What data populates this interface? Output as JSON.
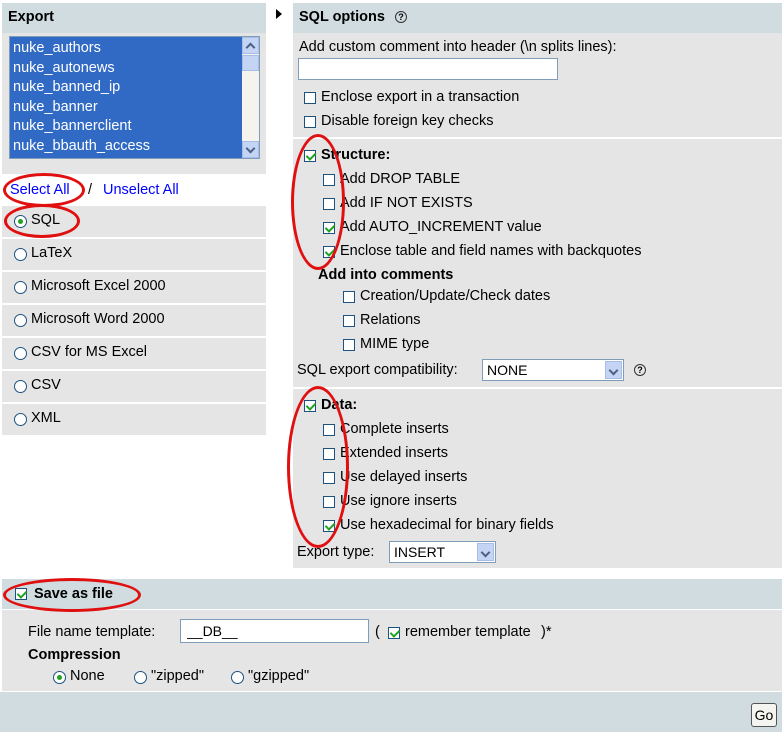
{
  "export": {
    "header": "Export",
    "tables": [
      "nuke_authors",
      "nuke_autonews",
      "nuke_banned_ip",
      "nuke_banner",
      "nuke_bannerclient",
      "nuke_bbauth_access"
    ],
    "select_all": "Select All",
    "separator": "/",
    "unselect_all": "Unselect All",
    "formats": [
      {
        "label": "SQL",
        "checked": true
      },
      {
        "label": "LaTeX",
        "checked": false
      },
      {
        "label": "Microsoft Excel 2000",
        "checked": false
      },
      {
        "label": "Microsoft Word 2000",
        "checked": false
      },
      {
        "label": "CSV for MS Excel",
        "checked": false
      },
      {
        "label": "CSV",
        "checked": false
      },
      {
        "label": "XML",
        "checked": false
      }
    ]
  },
  "sql_options": {
    "header": "SQL options",
    "comment_label": "Add custom comment into header (\\n splits lines):",
    "comment_value": "",
    "enclose_transaction": "Enclose export in a transaction",
    "disable_fk": "Disable foreign key checks",
    "structure": "Structure:",
    "add_drop": "Add DROP TABLE",
    "add_if_not_exists": "Add IF NOT EXISTS",
    "add_auto_increment": "Add AUTO_INCREMENT value",
    "enclose_backquotes": "Enclose table and field names with backquotes",
    "add_into_comments": "Add into comments",
    "creation_dates": "Creation/Update/Check dates",
    "relations": "Relations",
    "mime_type": "MIME type",
    "compat_label": "SQL export compatibility:",
    "compat_value": "NONE",
    "data": "Data:",
    "complete_inserts": "Complete inserts",
    "extended_inserts": "Extended inserts",
    "delayed_inserts": "Use delayed inserts",
    "ignore_inserts": "Use ignore inserts",
    "hex_binary": "Use hexadecimal for binary fields",
    "export_type_label": "Export type:",
    "export_type_value": "INSERT"
  },
  "save": {
    "header": "Save as file",
    "filename_label": "File name template:",
    "filename_value": "__DB__",
    "paren_open": "(",
    "remember": "remember template",
    "paren_close": ")*",
    "compression_label": "Compression",
    "none": "None",
    "zipped": "\"zipped\"",
    "gzipped": "\"gzipped\""
  },
  "go_label": "Go",
  "colors": {
    "panel": "#e5e5e5",
    "header": "#d0dce0",
    "selection": "#316ac5",
    "annotation": "#e01010",
    "link": "#0000ff"
  }
}
